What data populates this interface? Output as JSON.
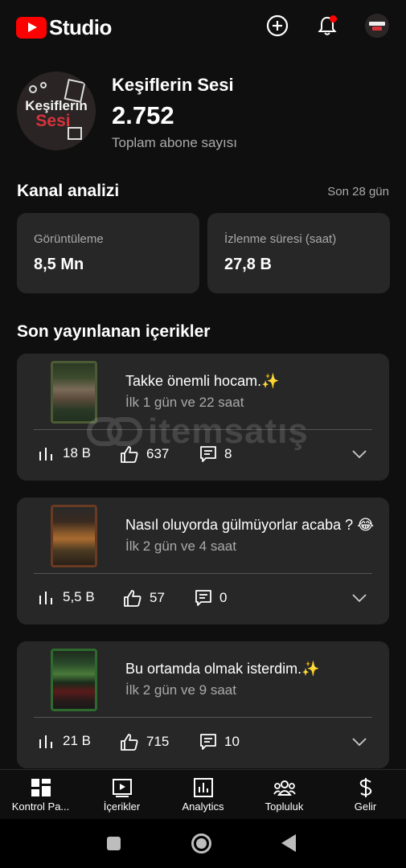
{
  "app": {
    "logo_text": "Studio"
  },
  "channel": {
    "name": "Keşiflerin Sesi",
    "subscriber_count": "2.752",
    "subscriber_label": "Toplam abone sayısı",
    "avatar_text_line1": "Keşiflerin",
    "avatar_text_line2": "Sesi"
  },
  "analytics": {
    "title": "Kanal analizi",
    "period": "Son 28 gün",
    "cards": [
      {
        "label": "Görüntüleme",
        "value": "8,5 Mn"
      },
      {
        "label": "İzlenme süresi (saat)",
        "value": "27,8 B"
      }
    ]
  },
  "recent": {
    "title": "Son yayınlanan içerikler",
    "items": [
      {
        "title": "Takke önemli hocam.✨",
        "age": "İlk 1 gün ve 22 saat",
        "views": "18 B",
        "likes": "637",
        "comments": "8"
      },
      {
        "title": "Nasıl oluyorda gülmüyorlar acaba ? 😂",
        "age": "İlk 2 gün ve 4 saat",
        "views": "5,5 B",
        "likes": "57",
        "comments": "0"
      },
      {
        "title": "Bu ortamda olmak isterdim.✨",
        "age": "İlk 2 gün ve 9 saat",
        "views": "21 B",
        "likes": "715",
        "comments": "10"
      }
    ]
  },
  "watermark": {
    "text": "itemsatış"
  },
  "bottom_nav": [
    {
      "label": "Kontrol Pa...",
      "icon": "dashboard-icon"
    },
    {
      "label": "İçerikler",
      "icon": "content-icon"
    },
    {
      "label": "Analytics",
      "icon": "analytics-icon"
    },
    {
      "label": "Topluluk",
      "icon": "community-icon"
    },
    {
      "label": "Gelir",
      "icon": "earn-icon"
    }
  ],
  "colors": {
    "accent": "#ff0000",
    "card": "#272727",
    "background": "#0f0f0f",
    "muted": "#aaaaaa"
  }
}
